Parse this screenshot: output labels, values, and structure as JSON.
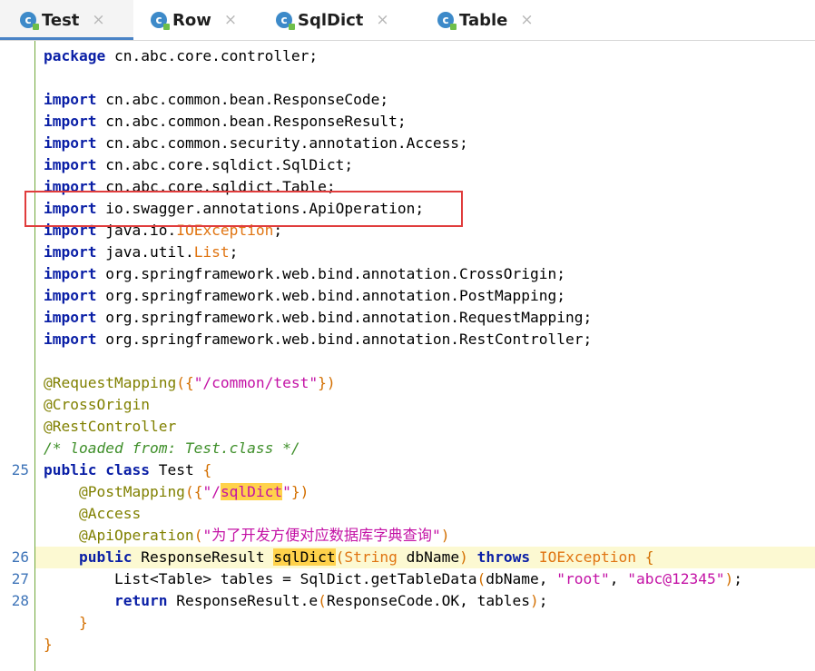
{
  "tabs": [
    {
      "label": "Test",
      "active": true,
      "icon": "class-c-icon"
    },
    {
      "label": "Row",
      "active": false,
      "icon": "class-c-icon"
    },
    {
      "label": "SqlDict",
      "active": false,
      "icon": "class-c-icon"
    },
    {
      "label": "Table",
      "active": false,
      "icon": "class-c-icon"
    }
  ],
  "tab_close_glyph": "×",
  "gutter": {
    "n25": "25",
    "n26": "26",
    "n27": "27",
    "n28": "28"
  },
  "code": {
    "l0": {
      "kw": "package",
      "rest": " cn.abc.core.controller;"
    },
    "imports": [
      {
        "kw": "import",
        "rest": " cn.abc.common.bean.ResponseCode;"
      },
      {
        "kw": "import",
        "rest": " cn.abc.common.bean.ResponseResult;"
      },
      {
        "kw": "import",
        "rest": " cn.abc.common.security.annotation.Access;"
      },
      {
        "kw": "import",
        "rest": " cn.abc.core.sqldict.SqlDict;"
      },
      {
        "kw": "import",
        "rest": " cn.abc.core.sqldict.Table;"
      },
      {
        "kw": "import",
        "rest": " io.swagger.annotations.ApiOperation;"
      },
      {
        "kw": "import",
        "rest": " java.io.",
        "extra": "IOException",
        "tail": ";"
      },
      {
        "kw": "import",
        "rest": " java.util.",
        "extra": "List",
        "tail": ";"
      },
      {
        "kw": "import",
        "rest": " org.springframework.web.bind.annotation.CrossOrigin;"
      },
      {
        "kw": "import",
        "rest": " org.springframework.web.bind.annotation.PostMapping;"
      },
      {
        "kw": "import",
        "rest": " org.springframework.web.bind.annotation.RequestMapping;"
      },
      {
        "kw": "import",
        "rest": " org.springframework.web.bind.annotation.RestController;"
      }
    ],
    "a1": {
      "ann": "@RequestMapping",
      "b1": "(",
      "c1": "{",
      "s": "\"/common/test\"",
      "c2": "}",
      "b2": ")"
    },
    "a2": "@CrossOrigin",
    "a3": "@RestController",
    "comment": "/* loaded from: Test.class */",
    "cls": {
      "kw1": "public",
      "kw2": "class",
      "name": " Test ",
      "brace": "{"
    },
    "pm": {
      "ann": "@PostMapping",
      "b1": "(",
      "c1": "{",
      "s1": "\"/",
      "sel": "sqlDict",
      "s2": "\"",
      "c2": "}",
      "b2": ")"
    },
    "acc": "@Access",
    "api": {
      "ann": "@ApiOperation",
      "b1": "(",
      "s": "\"为了开发方便对应数据库字典查询\"",
      "b2": ")"
    },
    "method": {
      "kw": "public",
      "t": " ResponseResult ",
      "name": "sqlDict",
      "b1": "(",
      "ptype": "String",
      "pname": " dbName",
      "b2": ")",
      "kw2": "throws",
      "exc": " IOException ",
      "brace": "{"
    },
    "l27": {
      "t1": "List<Table> tables = SqlDict.getTableData",
      "b1": "(",
      "t2": "dbName, ",
      "s1": "\"root\"",
      "t3": ", ",
      "s2": "\"abc@12345\"",
      "b2": ")",
      "t4": ";"
    },
    "l28": {
      "kw": "return",
      "t1": " ResponseResult.e",
      "b1": "(",
      "t2": "ResponseCode.OK, tables",
      "b2": ")",
      "t3": ";"
    },
    "close1": "}",
    "close2": "}"
  }
}
